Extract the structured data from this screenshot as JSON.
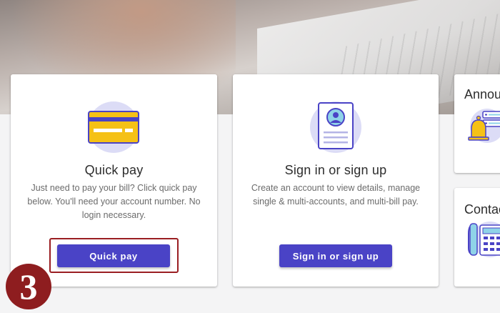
{
  "cards": {
    "quick_pay": {
      "title": "Quick pay",
      "desc_line1": "Just need to pay your bill? Click quick pay",
      "desc_line2": "below. You'll need your account number. No",
      "desc_line3": "login necessary.",
      "button_label": "Quick pay",
      "icon": "credit-card-icon"
    },
    "sign_in": {
      "title": "Sign in or sign up",
      "desc_line1": "Create an account to view details, manage",
      "desc_line2": "single & multi-accounts, and multi-bill pay.",
      "button_label": "Sign in or sign up",
      "icon": "profile-document-icon"
    },
    "announcements": {
      "title": "Annou",
      "icon": "bell-notification-icon"
    },
    "contact": {
      "title": "Contac",
      "icon": "telephone-icon"
    }
  },
  "step_badge": "3",
  "colors": {
    "button": "#4a43c6",
    "highlight": "#9a1e22",
    "badge": "#8e1d1f",
    "icon_circle": "#dcdcf6",
    "card_yellow": "#f5c116"
  }
}
